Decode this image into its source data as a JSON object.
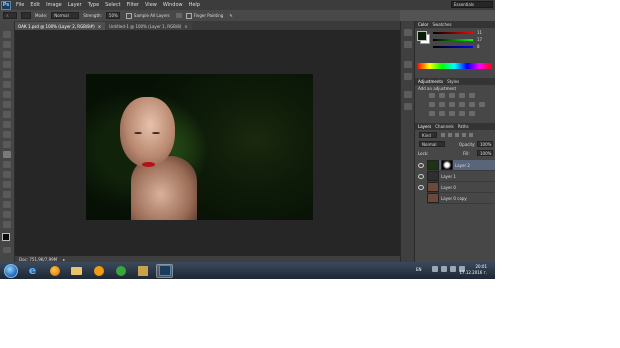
{
  "app": {
    "logo": "Ps"
  },
  "menu": [
    "File",
    "Edit",
    "Image",
    "Layer",
    "Type",
    "Select",
    "Filter",
    "View",
    "Window",
    "Help"
  ],
  "workspace": "Essentials",
  "options": {
    "mode_label": "Mode:",
    "mode_value": "Normal",
    "strength_label": "Strength:",
    "strength_value": "50%",
    "sample_all_layers": "Sample All Layers",
    "finger_painting": "Finger Painting"
  },
  "tabs": [
    {
      "label": "ОАК 1.psd @ 100% (Layer 2, RGB/8#)",
      "active": true
    },
    {
      "label": "Untitled-1 @ 100% (Layer 1, RGB/8)",
      "active": false
    }
  ],
  "status": {
    "doc": "Doc: 751,9K/7,99M"
  },
  "panels": {
    "color_tabs": [
      "Color",
      "Swatches"
    ],
    "color_values": [
      "11",
      "17",
      "8"
    ],
    "adjust_tabs": [
      "Adjustments",
      "Styles"
    ],
    "adjust_title": "Add an adjustment",
    "layers_tabs": [
      "Layers",
      "Channels",
      "Paths"
    ],
    "kind": "Kind",
    "blend": "Normal",
    "opacity_label": "Opacity:",
    "opacity_value": "100%",
    "lock_label": "Lock:",
    "fill_label": "Fill:",
    "fill_value": "100%",
    "layers": [
      "Layer 2",
      "Layer 1",
      "Layer 0",
      "Layer 0 copy"
    ]
  },
  "taskbar": {
    "lang": "EN",
    "time": "20:01",
    "date": "17.12.2016 г."
  },
  "colors": {
    "accent": "#58657a",
    "lips": "#b3121b"
  }
}
